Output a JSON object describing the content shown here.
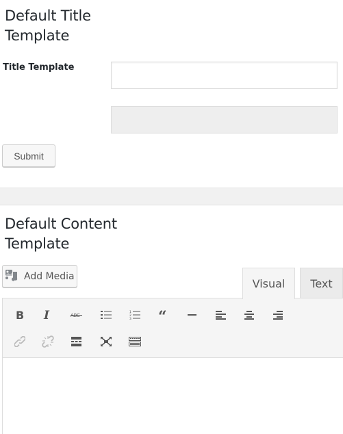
{
  "title_section": {
    "heading": "Default Title Template",
    "field_label": "Title Template",
    "title_input_value": "",
    "secondary_input_value": "",
    "submit_label": "Submit"
  },
  "content_section": {
    "heading": "Default Content Template",
    "add_media_label": "Add Media",
    "tabs": [
      {
        "label": "Visual",
        "active": true
      },
      {
        "label": "Text",
        "active": false
      }
    ],
    "toolbar_row1": [
      {
        "icon": "bold-icon",
        "title": "Bold"
      },
      {
        "icon": "italic-icon",
        "title": "Italic"
      },
      {
        "icon": "strikethrough-icon",
        "title": "Strikethrough"
      },
      {
        "icon": "bulleted-list-icon",
        "title": "Bulleted list"
      },
      {
        "icon": "numbered-list-icon",
        "title": "Numbered list"
      },
      {
        "icon": "blockquote-icon",
        "title": "Blockquote"
      },
      {
        "icon": "horizontal-line-icon",
        "title": "Horizontal line"
      },
      {
        "icon": "align-left-icon",
        "title": "Align left"
      },
      {
        "icon": "align-center-icon",
        "title": "Align center"
      },
      {
        "icon": "align-right-icon",
        "title": "Align right"
      }
    ],
    "toolbar_row2": [
      {
        "icon": "insert-link-icon",
        "title": "Insert/edit link"
      },
      {
        "icon": "remove-link-icon",
        "title": "Remove link"
      },
      {
        "icon": "read-more-icon",
        "title": "Insert Read More tag"
      },
      {
        "icon": "fullscreen-icon",
        "title": "Distraction-free writing mode"
      },
      {
        "icon": "toolbar-toggle-icon",
        "title": "Toolbar Toggle"
      }
    ],
    "editor_content": ""
  },
  "colors": {
    "icon": "#555555",
    "icon_disabled": "#bbbbbb",
    "toolbar_bg": "#f5f5f5",
    "border": "#dddddd"
  }
}
